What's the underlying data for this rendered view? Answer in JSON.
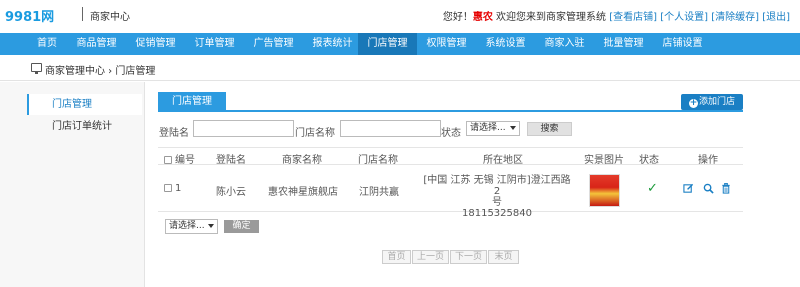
{
  "header": {
    "logo": "9981网",
    "section": "商家中心",
    "welcome_prefix": "您好！",
    "username": "惠农",
    "welcome_suffix": " 欢迎您来到商家管理系统 ",
    "links": [
      "[查看店铺]",
      "[个人设置]",
      "[清除缓存]",
      "[退出]"
    ]
  },
  "nav": {
    "items": [
      "首页",
      "商品管理",
      "促销管理",
      "订单管理",
      "广告管理",
      "报表统计",
      "门店管理",
      "权限管理",
      "系统设置",
      "商家入驻",
      "批量管理",
      "店铺设置"
    ],
    "active": "门店管理"
  },
  "breadcrumb": {
    "text": "商家管理中心 › 门店管理"
  },
  "sidebar": {
    "items": [
      "门店管理",
      "门店订单统计"
    ]
  },
  "content": {
    "tab": "门店管理",
    "add_button": "添加门店",
    "search": {
      "login_label": "登陆名",
      "store_label": "门店名称",
      "status_label": "状态",
      "status_value": "请选择...",
      "search_button": "搜索"
    },
    "table": {
      "headers": [
        "编号",
        "登陆名",
        "商家名称",
        "门店名称",
        "所在地区",
        "实景图片",
        "状态",
        "操作"
      ],
      "rows": [
        {
          "id": "1",
          "login": "陈小云",
          "merchant": "惠农神星旗舰店",
          "store": "江阴共赢",
          "region_line1": "[中国  江苏  无锡  江阴市]澄江西路2",
          "region_line2": "号",
          "region_line3": "18115325840",
          "status": "✓"
        }
      ]
    },
    "bulk": {
      "select_value": "请选择...",
      "confirm": "确定"
    },
    "pagination": [
      "首页",
      "上一页",
      "下一页",
      "末页"
    ]
  },
  "colors": {
    "nav": "#2c9be0",
    "nav_active": "#1978b8",
    "accent": "#1a7fc4",
    "status_ok": "#1a9a3a"
  }
}
